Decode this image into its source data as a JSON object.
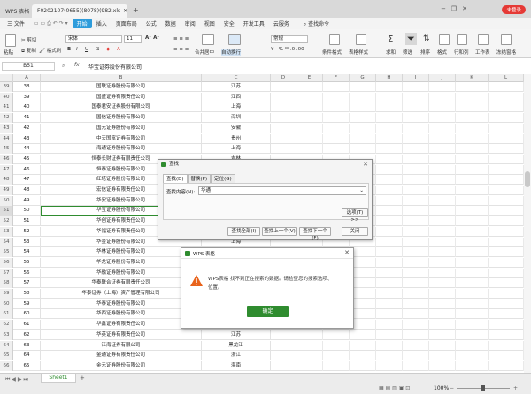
{
  "titlebar": {
    "app_tab": "WPS 表格",
    "file_tab": "F0202107(0655)(8078)(982.xls",
    "login": "未登录"
  },
  "menu": {
    "items": [
      "三 文件",
      "开始",
      "插入",
      "页面布局",
      "公式",
      "数据",
      "审阅",
      "视图",
      "安全",
      "开发工具",
      "云服务"
    ],
    "active_index": 1,
    "search": "查找命令"
  },
  "toolbar": {
    "cut": "剪切",
    "copy": "复制",
    "paste": "粘贴",
    "format_painter": "格式刷",
    "font": "宋体",
    "font_size": "11",
    "number_format": "常规",
    "merge": "合并居中",
    "wrap": "自动换行",
    "conditional": "条件格式",
    "table_style": "表格样式",
    "sum": "求和",
    "filter": "筛选",
    "sort": "排序",
    "format": "格式",
    "rowcol": "行和列",
    "worksheet": "工作表",
    "freeze": "冻结窗格"
  },
  "formula_bar": {
    "cell_ref": "B51",
    "fx": "fx",
    "value": "华宝证券股份有限公司"
  },
  "columns": [
    "A",
    "B",
    "C",
    "D",
    "E",
    "F",
    "G",
    "H",
    "I",
    "J",
    "K",
    "L"
  ],
  "rows": [
    {
      "n": "39",
      "a": "38",
      "b": "国联证券股份有限公司",
      "c": "江苏"
    },
    {
      "n": "40",
      "a": "39",
      "b": "国盛证券有限责任公司",
      "c": "江西"
    },
    {
      "n": "41",
      "a": "40",
      "b": "国泰君安证券股份有限公司",
      "c": "上海"
    },
    {
      "n": "42",
      "a": "41",
      "b": "国信证券股份有限公司",
      "c": "深圳"
    },
    {
      "n": "43",
      "a": "42",
      "b": "国元证券股份有限公司",
      "c": "安徽"
    },
    {
      "n": "44",
      "a": "43",
      "b": "中天国富证券有限公司",
      "c": "贵州"
    },
    {
      "n": "45",
      "a": "44",
      "b": "海通证券股份有限公司",
      "c": "上海"
    },
    {
      "n": "46",
      "a": "45",
      "b": "恒泰长财证券有限责任公司",
      "c": "吉林"
    },
    {
      "n": "47",
      "a": "46",
      "b": "恒泰证券股份有限公司",
      "c": ""
    },
    {
      "n": "48",
      "a": "47",
      "b": "红塔证券股份有限公司",
      "c": ""
    },
    {
      "n": "49",
      "b": "宏信证券有限责任公司",
      "a": "48",
      "c": ""
    },
    {
      "n": "50",
      "a": "49",
      "b": "华安证券股份有限公司",
      "c": ""
    },
    {
      "n": "51",
      "a": "50",
      "b": "华宝证券股份有限公司",
      "c": ""
    },
    {
      "n": "52",
      "a": "51",
      "b": "华创证券有限责任公司",
      "c": ""
    },
    {
      "n": "53",
      "a": "52",
      "b": "华福证券有限责任公司",
      "c": ""
    },
    {
      "n": "54",
      "a": "53",
      "b": "华金证券股份有限公司",
      "c": "上海"
    },
    {
      "n": "55",
      "a": "54",
      "b": "华林证券股份有限公司",
      "c": ""
    },
    {
      "n": "56",
      "a": "55",
      "b": "华龙证券股份有限公司",
      "c": ""
    },
    {
      "n": "57",
      "a": "56",
      "b": "华融证券股份有限公司",
      "c": ""
    },
    {
      "n": "58",
      "a": "57",
      "b": "华泰联合证券有限责任公司",
      "c": ""
    },
    {
      "n": "59",
      "a": "58",
      "b": "华泰证券（上海）资产管理有限公司",
      "c": ""
    },
    {
      "n": "60",
      "a": "59",
      "b": "华泰证券股份有限公司",
      "c": ""
    },
    {
      "n": "61",
      "a": "60",
      "b": "华西证券股份有限公司",
      "c": ""
    },
    {
      "n": "62",
      "a": "61",
      "b": "华鑫证券有限责任公司",
      "c": "江苏"
    },
    {
      "n": "63",
      "a": "62",
      "b": "华英证券有限责任公司",
      "c": "江苏"
    },
    {
      "n": "64",
      "a": "63",
      "b": "江海证券有限公司",
      "c": "黑龙江"
    },
    {
      "n": "65",
      "a": "64",
      "b": "金通证券有限责任公司",
      "c": "浙江"
    },
    {
      "n": "66",
      "a": "65",
      "b": "金元证券股份有限公司",
      "c": "海南"
    }
  ],
  "find_dialog": {
    "title": "查找",
    "tabs": [
      "查找(D)",
      "替换(P)",
      "定位(G)"
    ],
    "label": "查找内容(N):",
    "value": "华通",
    "options_btn": "选项(T) >>",
    "find_all": "查找全部(I)",
    "find_prev": "查找上一个(V)",
    "find_next": "查找下一个(F)",
    "close": "关闭"
  },
  "alert": {
    "title": "WPS 表格",
    "message_1": "WPS表格 找不到正在搜索的数据。请检查您的搜索选项、",
    "message_2": "位置。",
    "ok": "确定"
  },
  "status": {
    "sheet": "Sheet1",
    "zoom": "100%"
  },
  "colors": {
    "accent": "#2e9cdb",
    "ok_button": "#2f8c2f",
    "selected_cell": "#2f8c2f",
    "warning": "#e8631c"
  }
}
